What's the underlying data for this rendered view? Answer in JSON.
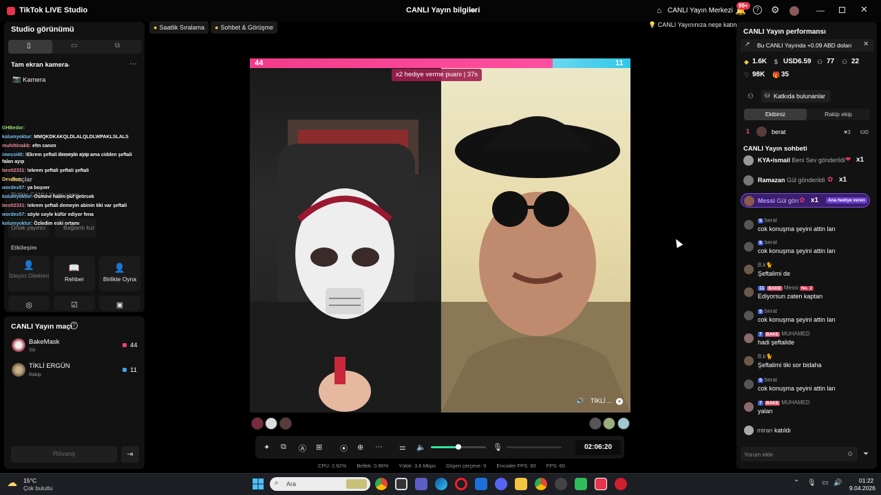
{
  "titlebar": {
    "app_title": "TikTok LIVE Studio",
    "live_info": "CANLI Yayın bilgileri",
    "center_label": "CANLI Yayın Merkezi",
    "notif_badge": "99+"
  },
  "left": {
    "studio_view": "Studio görünümü",
    "full_screen_camera": "Tam ekran kamera",
    "camera_label": "Kamera",
    "ghost_add_source": "Kaynak ekle",
    "ghost_tools": "Araçlar",
    "ghost_together": "Birlikte CANLI Yayın yapın",
    "ghost_play": "Ortak yayıncı",
    "ghost_joint": "Bağlantı kur",
    "interaction_label": "Etkileşim",
    "tiles": [
      {
        "label": "İzleyici Dilekleri",
        "dim": true,
        "icon": "person-icon"
      },
      {
        "label": "Rehber",
        "dim": false,
        "icon": "book-icon"
      },
      {
        "label": "Birlikte Oyna",
        "dim": false,
        "icon": "person-play-icon"
      }
    ],
    "tiles_row2_icons": [
      "target-icon",
      "checklist-icon",
      "box-icon"
    ],
    "match_title": "CANLI Yayın maçı",
    "players": [
      {
        "name": "BakeMask",
        "role": "Siz",
        "score": "44",
        "dot_color": "#f0406e"
      },
      {
        "name": "TİKLİ ERGÜN",
        "role": "Rakip",
        "score": "11",
        "dot_color": "#3fa6f0"
      }
    ],
    "rematch": "Rövanş"
  },
  "overlay_chat": [
    {
      "name": "GHBedor:",
      "text": "",
      "cls": "ov-name3"
    },
    {
      "name": "kolumyoktur:",
      "text": "MMQKDKAKQLDLALQLDLWPAKLSLALS",
      "cls": "ov-name"
    },
    {
      "name": "muhittinakb:",
      "text": "efm canım",
      "cls": "ov-name2"
    },
    {
      "name": "imessi40:",
      "text": "!Ekrem şeftali demeyin ayıp ama cidden şeftali",
      "cls": "ov-name"
    },
    {
      "name": "",
      "text": "falan ayıp",
      "cls": "ov-name"
    },
    {
      "name": "bestt2331:",
      "text": "!ekrem şeftali şeftali şeftali",
      "cls": "ov-name2"
    },
    {
      "name": "Desdkat:",
      "text": "",
      "cls": "ov-name4"
    },
    {
      "name": "wordex57:",
      "text": "ya boşver",
      "cls": "ov-name"
    },
    {
      "name": "kolumyoktur:",
      "text": "Osmine halen puf getircek",
      "cls": "ov-name"
    },
    {
      "name": "bestt2331:",
      "text": "!ekrem şeftali demeyin abinin tiki var şeftali",
      "cls": "ov-name2"
    },
    {
      "name": "wordex57:",
      "text": "söyle soyle küfür ediyor fena",
      "cls": "ov-name"
    },
    {
      "name": "kolumyoktur:",
      "text": "Özledim eski ortamı",
      "cls": "ov-name"
    }
  ],
  "top_chips": [
    {
      "label": "Saatlik Sıralama"
    },
    {
      "label": "Sohbet & Görüşme"
    }
  ],
  "tip": "CANLI Yayınınıza neşe katın",
  "battle": {
    "score_left": "44",
    "score_right": "11",
    "x2_banner": "x2 hediye verme puanı  |  37s",
    "right_name": "TİKLİ ..."
  },
  "controls": {
    "timer": "02:06:20",
    "volume_level": 0.5
  },
  "stats": {
    "cpu": "CPU:  2.92%",
    "memory": "Bellek:  0.96%",
    "upload": "Yükle:  3.6 Mbps",
    "dropped": "Düşen çerçeve:  0",
    "encoder": "Encoder FPS:  60",
    "fps": "FPS:  60"
  },
  "right": {
    "perf_title": "CANLI Yayın performansı",
    "earn_text": "Bu CANLI Yayında +0.09 ABD doları",
    "stats": [
      {
        "icon": "diamond-icon",
        "value": "1.6K"
      },
      {
        "icon": "dollar-icon",
        "value": "USD6.59"
      },
      {
        "icon": "viewers-icon",
        "value": "77"
      },
      {
        "icon": "new-followers-icon",
        "value": "22"
      },
      {
        "icon": "heart-icon",
        "value": "98K"
      },
      {
        "icon": "gift-icon",
        "value": "35"
      }
    ],
    "contributors_btn": "Katkıda bulunanlar",
    "tab_ours": "Ekibiniz",
    "tab_rival": "Rakip ekip",
    "rank": {
      "num": "1",
      "name": "berat",
      "likes": "3",
      "gifts": "0"
    },
    "chat_title": "CANLI Yayın sohbeti",
    "gifts": [
      {
        "user": "KYA•ismail",
        "desc": "Beni Sev gönderildi",
        "count": "x1"
      },
      {
        "user": "Ramazan",
        "desc": "Gül gönderildi",
        "count": "x1"
      },
      {
        "user": "Messi",
        "desc": "Gül gön",
        "count": "x1"
      }
    ],
    "main_gift_badge": "Ana hediye veren",
    "messages": [
      {
        "meta_lvl": "5",
        "meta_fan": "",
        "meta_name": "berat",
        "text": "cok konuşma şeyini attin lan",
        "partial": true
      },
      {
        "meta_lvl": "5",
        "meta_fan": "",
        "meta_name": "berat",
        "text": "cok konuşma şeyini attin lan",
        "partial": false
      },
      {
        "meta_lvl": "",
        "meta_fan": "",
        "meta_name": "B.k🐈",
        "text": "Şeftalimi de",
        "partial": false
      },
      {
        "meta_lvl": "11",
        "meta_fan": "BAKE",
        "meta_name": "Messi",
        "text": "Ediyorsun zaten kaptan",
        "partial": false,
        "no2": "No. 2"
      },
      {
        "meta_lvl": "5",
        "meta_fan": "",
        "meta_name": "berat",
        "text": "cok konuşma şeyini attin lan",
        "partial": false
      },
      {
        "meta_lvl": "7",
        "meta_fan": "BAKE",
        "meta_name": "MUHAMED",
        "text": "hadi şeftalide",
        "partial": false
      },
      {
        "meta_lvl": "",
        "meta_fan": "",
        "meta_name": "B.k🐈",
        "text": "Şeftalimi tiki sor bidaha",
        "partial": false
      },
      {
        "meta_lvl": "5",
        "meta_fan": "",
        "meta_name": "berat",
        "text": "cok konuşma şeyini attin lan",
        "partial": false
      },
      {
        "meta_lvl": "7",
        "meta_fan": "BAKE",
        "meta_name": "MUHAMED",
        "text": "yalan",
        "partial": false
      }
    ],
    "join": {
      "name": "miran",
      "text": "katıldı"
    },
    "comment_placeholder": "Yorum ekle"
  },
  "taskbar": {
    "temp": "15°C",
    "weather": "Çok bulutlu",
    "search_placeholder": "Ara",
    "time": "01:22",
    "date": "9.04.2026"
  }
}
